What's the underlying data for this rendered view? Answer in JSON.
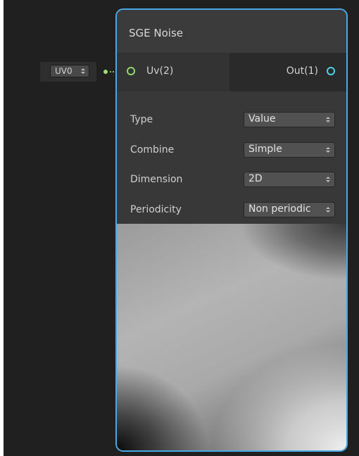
{
  "input_node": {
    "selected": "UV0"
  },
  "node": {
    "title": "SGE Noise",
    "input_port": {
      "label": "Uv(2)"
    },
    "output_port": {
      "label": "Out(1)"
    },
    "properties": [
      {
        "label": "Type",
        "value": "Value"
      },
      {
        "label": "Combine",
        "value": "Simple"
      },
      {
        "label": "Dimension",
        "value": "2D"
      },
      {
        "label": "Periodicity",
        "value": "Non periodic"
      }
    ]
  },
  "colors": {
    "node_border": "#4aa8e6",
    "input_port": "#8fd86a",
    "output_port": "#4dd0e8",
    "wire": "#7ec25a",
    "canvas": "#202020"
  },
  "icons": {
    "dropdown": "updown-arrows-icon",
    "input_port": "port-ring-icon",
    "output_port": "port-ring-icon"
  }
}
